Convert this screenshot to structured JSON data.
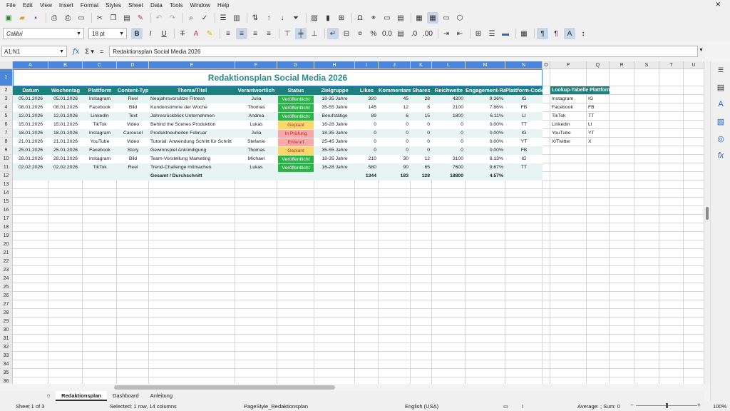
{
  "menu": [
    "File",
    "Edit",
    "View",
    "Insert",
    "Format",
    "Styles",
    "Sheet",
    "Data",
    "Tools",
    "Window",
    "Help"
  ],
  "toolbar": {
    "font_name": "Calibri",
    "font_size": "18 pt"
  },
  "formula": {
    "name_box": "A1:N1",
    "content": "Redaktionsplan Social Media 2026"
  },
  "columns": [
    "A",
    "B",
    "C",
    "D",
    "E",
    "F",
    "G",
    "H",
    "I",
    "J",
    "K",
    "L",
    "M",
    "N",
    "O",
    "P",
    "Q",
    "R",
    "S",
    "T",
    "U"
  ],
  "sheet": {
    "title": "Redaktionsplan Social Media 2026",
    "headers": [
      "Datum",
      "Wochentag",
      "Plattform",
      "Content-Typ",
      "Thema/Titel",
      "Verantwortlich",
      "Status",
      "Zielgruppe",
      "Likes",
      "Kommentare",
      "Shares",
      "Reichweite",
      "Engagement-Rate",
      "Plattform-Code"
    ],
    "rows": [
      [
        "05.01.2026",
        "05.01.2026",
        "Instagram",
        "Reel",
        "Neujahrsvorsätze Fitness",
        "Julia",
        "Veröffentlicht",
        "18-35 Jahre",
        "320",
        "45",
        "28",
        "4200",
        "9.36%",
        "IG"
      ],
      [
        "08.01.2026",
        "08.01.2026",
        "Facebook",
        "Bild",
        "Kundenstimme der Woche",
        "Thomas",
        "Veröffentlicht",
        "35-55 Jahre",
        "145",
        "12",
        "8",
        "2100",
        "7.86%",
        "FB"
      ],
      [
        "12.01.2026",
        "12.01.2026",
        "LinkedIn",
        "Text",
        "Jahresrückblick Unternehmen",
        "Andrea",
        "Veröffentlicht",
        "Berufstätige",
        "89",
        "6",
        "15",
        "1800",
        "6.11%",
        "LI"
      ],
      [
        "15.01.2026",
        "15.01.2026",
        "TikTok",
        "Video",
        "Behind the Scenes Produktion",
        "Lukas",
        "Geplant",
        "16-28 Jahre",
        "0",
        "0",
        "0",
        "0",
        "0.00%",
        "TT"
      ],
      [
        "18.01.2026",
        "18.01.2026",
        "Instagram",
        "Carousel",
        "Produktneuheiten Februar",
        "Julia",
        "In Prüfung",
        "18-35 Jahre",
        "0",
        "0",
        "0",
        "0",
        "0.00%",
        "IG"
      ],
      [
        "21.01.2026",
        "21.01.2026",
        "YouTube",
        "Video",
        "Tutorial: Anwendung Schritt für Schritt",
        "Stefanie",
        "Entwurf",
        "25-45 Jahre",
        "0",
        "0",
        "0",
        "0",
        "0.00%",
        "YT"
      ],
      [
        "25.01.2026",
        "25.01.2026",
        "Facebook",
        "Story",
        "Gewinnspiel Ankündigung",
        "Thomas",
        "Geplant",
        "35-55 Jahre",
        "0",
        "0",
        "0",
        "0",
        "0.00%",
        "FB"
      ],
      [
        "28.01.2026",
        "28.01.2026",
        "Instagram",
        "Bild",
        "Team-Vorstellung Marketing",
        "Michael",
        "Veröffentlicht",
        "18-35 Jahre",
        "210",
        "30",
        "12",
        "3100",
        "8.13%",
        "IG"
      ],
      [
        "02.02.2026",
        "02.02.2026",
        "TikTok",
        "Reel",
        "Trend-Challenge mitmachen",
        "Lukas",
        "Veröffentlicht",
        "16-28 Jahre",
        "580",
        "90",
        "65",
        "7600",
        "9.67%",
        "TT"
      ]
    ],
    "totals": {
      "label": "Gesamt / Durchschnitt",
      "likes": "1344",
      "comments": "183",
      "shares": "128",
      "reach": "18800",
      "rate": "4.57%"
    },
    "lookup": {
      "header": "Lookup-Tabelle Plattformen",
      "rows": [
        [
          "Instagram",
          "IG"
        ],
        [
          "Facebook",
          "FB"
        ],
        [
          "TikTok",
          "TT"
        ],
        [
          "LinkedIn",
          "LI"
        ],
        [
          "YouTube",
          "YT"
        ],
        [
          "X/Twitter",
          "X"
        ]
      ]
    },
    "status_colors": {
      "Veröffentlicht": "#2db34a",
      "Geplant": "#f7d96b",
      "In Prüfung": "#f7a8a8",
      "Entwurf": "#f7a8a8"
    }
  },
  "tabs": [
    "Redaktionsplan",
    "Dashboard",
    "Anleitung"
  ],
  "status": {
    "sheet": "Sheet 1 of 3",
    "selection": "Selected: 1 row, 14 columns",
    "page_style": "PageStyle_Redaktionsplan",
    "language": "English (USA)",
    "sum": "Average: ; Sum: 0",
    "zoom": "100%"
  }
}
